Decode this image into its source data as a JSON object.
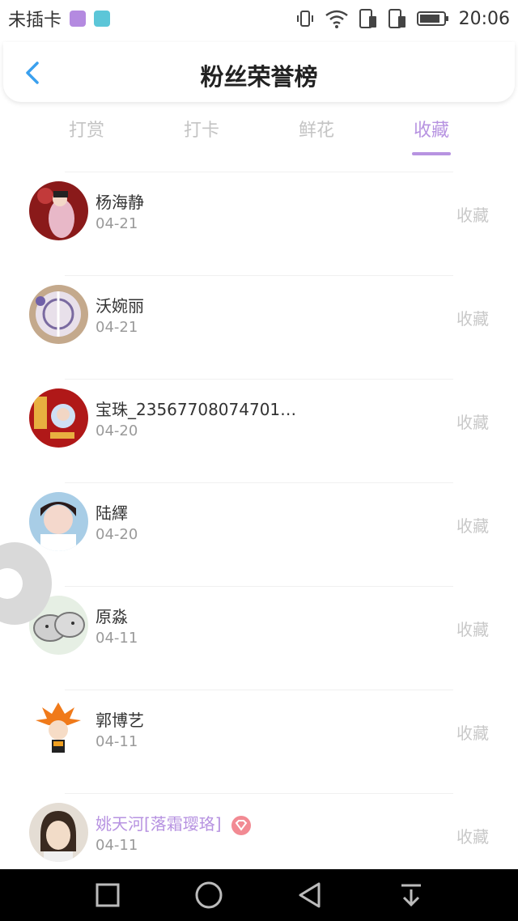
{
  "status_bar": {
    "carrier": "未插卡",
    "time": "20:06"
  },
  "header": {
    "title": "粉丝荣誉榜"
  },
  "tabs": [
    {
      "label": "打赏",
      "active": false
    },
    {
      "label": "打卡",
      "active": false
    },
    {
      "label": "鲜花",
      "active": false
    },
    {
      "label": "收藏",
      "active": true
    }
  ],
  "fans": [
    {
      "name": "杨海静",
      "date": "04-21",
      "action": "收藏",
      "vip": false
    },
    {
      "name": "沃婉丽",
      "date": "04-21",
      "action": "收藏",
      "vip": false
    },
    {
      "name": "宝珠_23567708074701…",
      "date": "04-20",
      "action": "收藏",
      "vip": false
    },
    {
      "name": "陆繹",
      "date": "04-20",
      "action": "收藏",
      "vip": false
    },
    {
      "name": "原淼",
      "date": "04-11",
      "action": "收藏",
      "vip": false
    },
    {
      "name": "郭博艺",
      "date": "04-11",
      "action": "收藏",
      "vip": false
    },
    {
      "name": "姚天河[落霜璎珞]",
      "date": "04-11",
      "action": "收藏",
      "vip": true
    }
  ],
  "colors": {
    "accent": "#b793e1",
    "back_arrow": "#3aa0ee",
    "muted": "#c8c8c8"
  }
}
